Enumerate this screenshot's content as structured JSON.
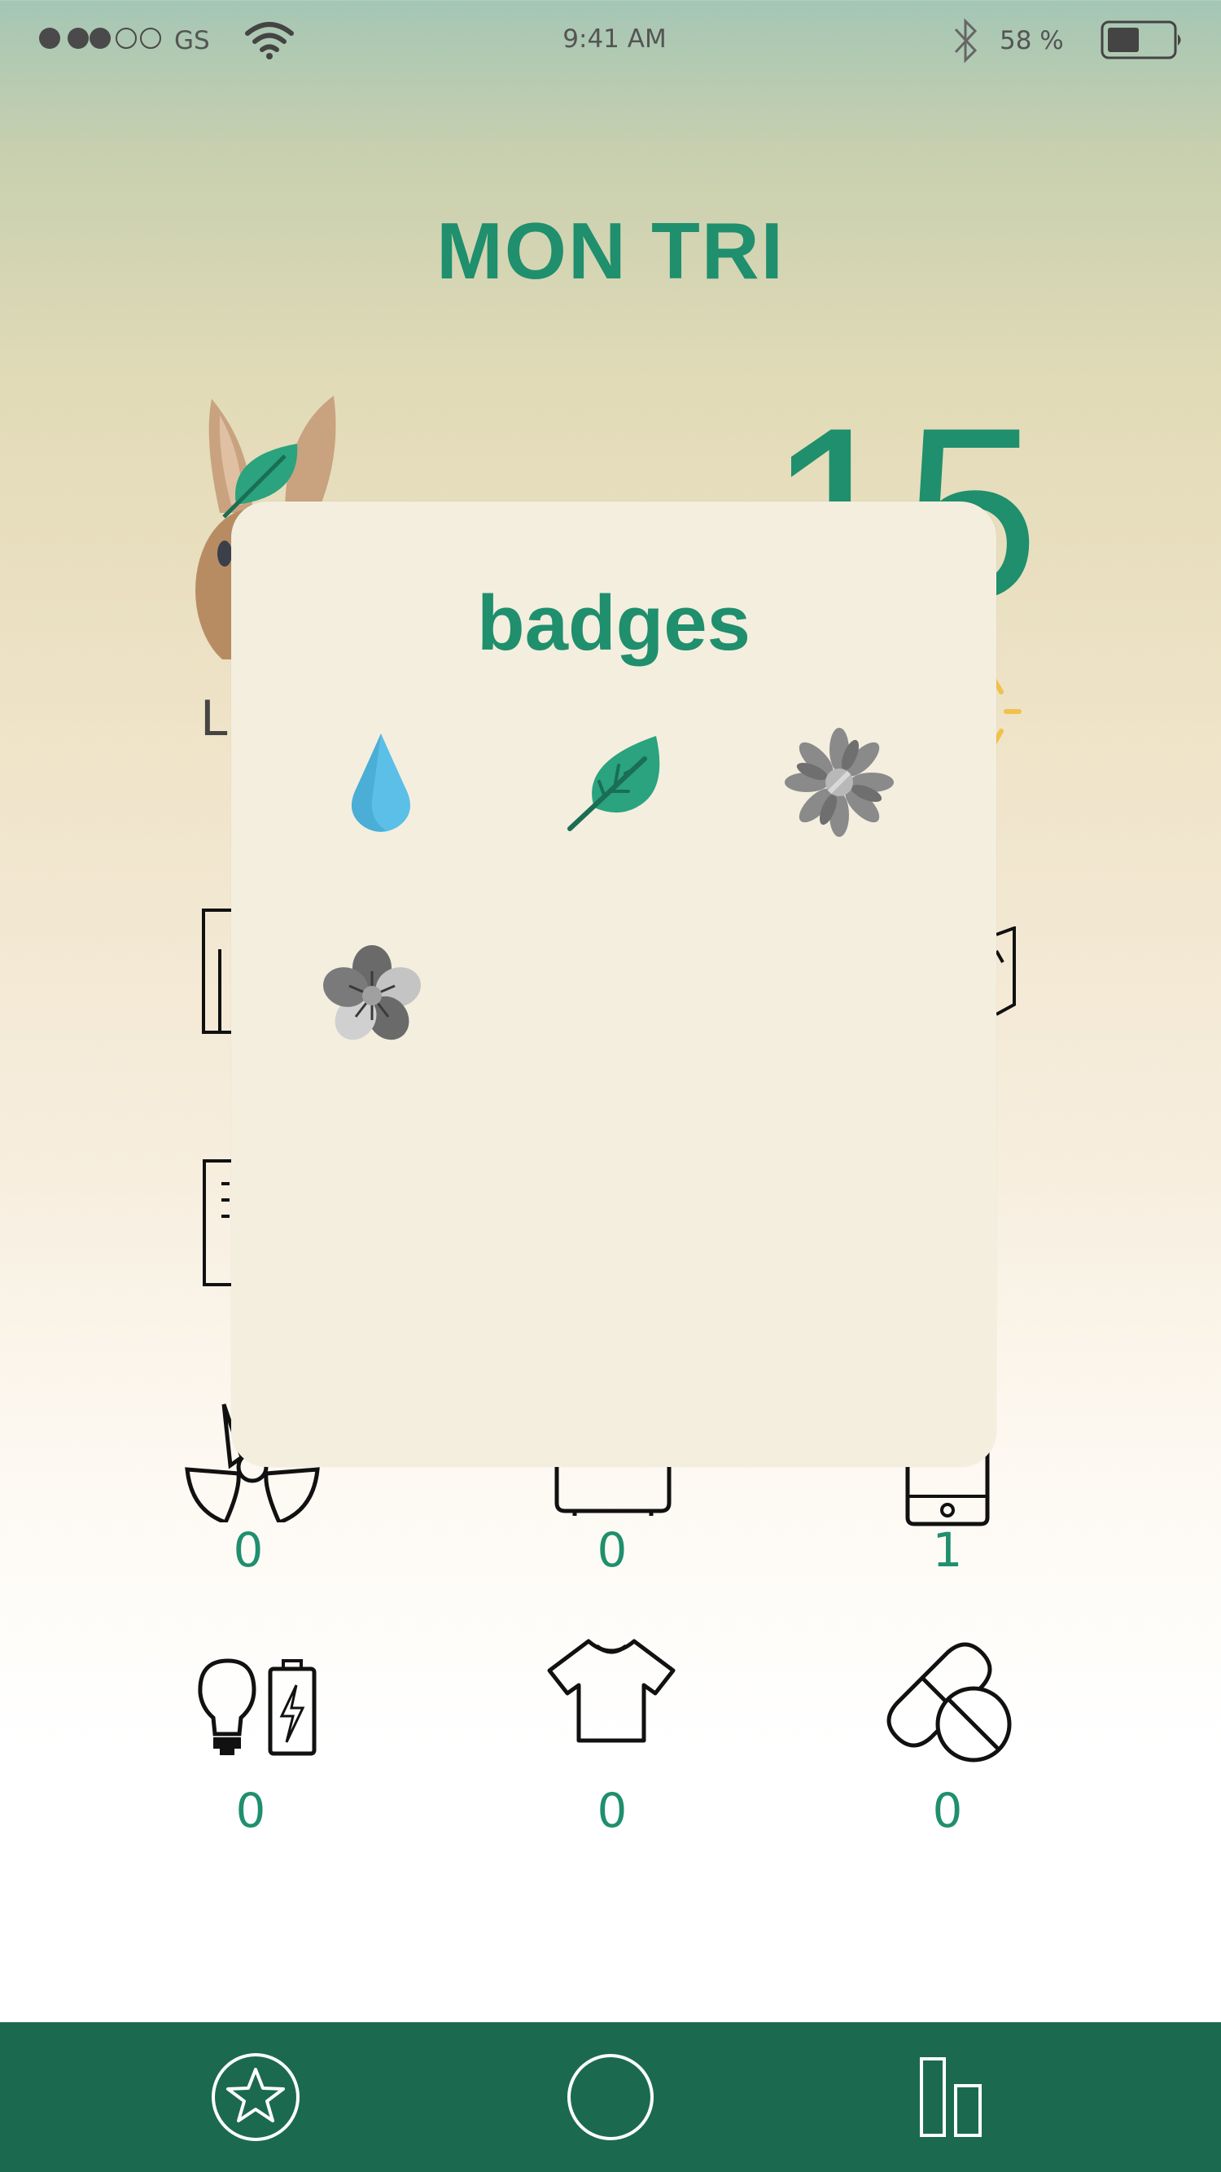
{
  "status_bar": {
    "carrier": "GS",
    "time": "9:41 AM",
    "battery_percent": "58 %",
    "signal_bars_filled": 3,
    "signal_bars_total": 6,
    "battery_level": 0.58
  },
  "header": {
    "title": "MON TRI"
  },
  "profile": {
    "name_fragment": "Li",
    "score_fragment": "15"
  },
  "badges_modal": {
    "title": "badges",
    "badges": [
      {
        "icon": "water-drop-icon",
        "color": "#5bbfe8"
      },
      {
        "icon": "leaf-icon",
        "color": "#2aa37e"
      },
      {
        "icon": "sunflower-icon",
        "color": "#8a8a8a"
      },
      {
        "icon": "flower-icon",
        "color": "#6a6a6a"
      }
    ]
  },
  "categories": [
    {
      "icon": "radioactive-icon",
      "count": "0"
    },
    {
      "icon": "appliance-icon",
      "count": "0"
    },
    {
      "icon": "phone-icon",
      "count": "1"
    },
    {
      "icon": "bulb-battery-icon",
      "count": "0"
    },
    {
      "icon": "tshirt-icon",
      "count": "0"
    },
    {
      "icon": "pills-icon",
      "count": "0"
    }
  ],
  "tab_bar": {
    "tabs": [
      {
        "icon": "star-icon"
      },
      {
        "icon": "circle-icon"
      },
      {
        "icon": "bar-chart-icon"
      }
    ]
  },
  "colors": {
    "accent": "#1f8f6d",
    "tab_bar": "#1b6a50",
    "modal_bg": "#f4eedf"
  }
}
